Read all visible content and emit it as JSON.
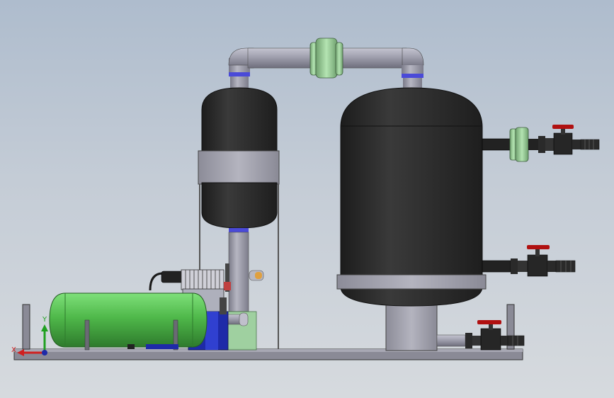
{
  "viewport": {
    "triad": {
      "x_label": "X",
      "y_label": "Y"
    },
    "colors": {
      "background_top": "#aebccd",
      "background_bottom": "#d6dade",
      "tank_black": "#2a2a2a",
      "pipe_gray": "#9a9aa8",
      "flange_green": "#9bcf9a",
      "receiver_green": "#4fb84a",
      "ring_blue": "#4a4ad8",
      "motor_blue": "#1e2aa8",
      "axis_x": "#d02020",
      "axis_y": "#20a020"
    }
  }
}
